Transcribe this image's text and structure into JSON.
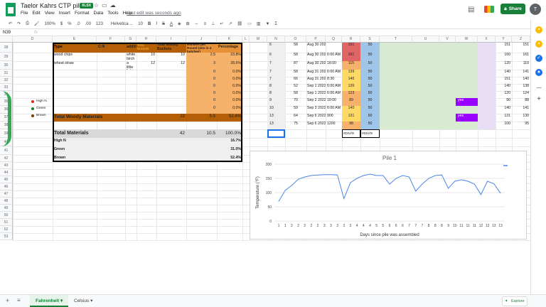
{
  "app": {
    "title": "Taelor Kahrs CTP pile 2",
    "file_badge": "XLSX",
    "last_edit": "Last edit was seconds ago",
    "share_label": "Share",
    "avatar_letter": "T",
    "menu": [
      "File",
      "Edit",
      "View",
      "Insert",
      "Format",
      "Data",
      "Tools",
      "Help"
    ]
  },
  "toolbar": {
    "zoom": "100%",
    "currency": "$",
    "percent": "%",
    "dec_decrease": ".0",
    "dec_increase": ".00",
    "number_format": "123",
    "font": "Helvetica ...",
    "font_size": "10",
    "bold": "B",
    "italic": "I",
    "strike": "S",
    "text_color": "A"
  },
  "formula_bar": {
    "cell_ref": "N39",
    "fx": "fx"
  },
  "columns": [
    "D",
    "E",
    "F",
    "G",
    "H",
    "I",
    "J",
    "K",
    "L",
    "M",
    "N",
    "O",
    "P",
    "Q",
    "R",
    "S",
    "T",
    "U",
    "V",
    "W",
    "X",
    "Y",
    "Z"
  ],
  "rows": [
    "28",
    "29",
    "30",
    "31",
    "32",
    "33",
    "34",
    "35",
    "36",
    "37",
    "38",
    "39",
    "40",
    "41",
    "42",
    "43",
    "44",
    "45",
    "46",
    "47",
    "48",
    "49",
    "50",
    "51",
    "52",
    "53"
  ],
  "legend": [
    {
      "label": "High N",
      "color": "#d93025"
    },
    {
      "label": "Green",
      "color": "#188038"
    },
    {
      "label": "Brown",
      "color": "#7b3f00"
    }
  ],
  "materials": {
    "headers": {
      "type": "Type",
      "cn": "C:N",
      "notes": "additional notes",
      "total": "Total Buckets",
      "true_woody": "True Woody Buckets",
      "per_round": "Buckets per Round (mix in 4 batches)",
      "pct": "Percentage"
    },
    "rows": [
      {
        "type": "wood chips",
        "notes": "white birch",
        "total": "10",
        "true": "10",
        "round": "2.5",
        "pct": "23.8%"
      },
      {
        "type": "wheat straw",
        "notes": "a little lighter than wood chips",
        "total": "12",
        "true": "12",
        "round": "3",
        "pct": "28.6%"
      },
      {
        "round": "0",
        "pct": "0.0%"
      },
      {
        "round": "0",
        "pct": "0.0%"
      },
      {
        "round": "0",
        "pct": "0.0%"
      },
      {
        "round": "0",
        "pct": "0.0%"
      },
      {
        "round": "0",
        "pct": "0.0%"
      },
      {
        "round": "0",
        "pct": "0.0%"
      }
    ],
    "total_woody": {
      "label": "Total Woody Materials",
      "true": "22",
      "round": "5.5",
      "pct": "52.4%"
    },
    "total": {
      "label": "Total Materials",
      "true": "42",
      "round": "10.5",
      "pct": "100.0%"
    },
    "summary": [
      {
        "label": "High N",
        "pct": "16.7%"
      },
      {
        "label": "Green",
        "pct": "31.0%"
      },
      {
        "label": "Brown",
        "pct": "52.4%"
      }
    ]
  },
  "log": {
    "rows": [
      {
        "n": "6",
        "o": "58",
        "p": "Aug 30 2022",
        "q": "",
        "r": "151",
        "s": "50",
        "y": "151",
        "z": "151"
      },
      {
        "n": "6",
        "o": "58",
        "p": "Aug 30 2022",
        "q": "6:00 AM",
        "r": "161",
        "s": "50",
        "y": "160",
        "z": "161"
      },
      {
        "n": "7",
        "o": "87",
        "p": "Aug 30 2022",
        "q": "18:00",
        "r": "115",
        "s": "50",
        "y": "120",
        "z": "110"
      },
      {
        "n": "7",
        "o": "58",
        "p": "Aug 31 2022",
        "q": "6:00 AM",
        "r": "139",
        "s": "50",
        "y": "140",
        "z": "141"
      },
      {
        "n": "7",
        "o": "66",
        "p": "Aug 31 2022",
        "q": "8:30",
        "r": "146",
        "s": "50",
        "y": "151",
        "z": "140"
      },
      {
        "n": "8",
        "o": "52",
        "p": "Sep 1 2022",
        "q": "6:00 AM",
        "r": "139",
        "s": "50",
        "y": "140",
        "z": "138"
      },
      {
        "n": "8",
        "o": "58",
        "p": "Sep 1 2022",
        "q": "6:00 AM",
        "r": "123",
        "s": "50",
        "y": "120",
        "z": "124"
      },
      {
        "n": "9",
        "o": "70",
        "p": "Sep 2 2022",
        "q": "10:00",
        "r": "89",
        "s": "50",
        "w": "yes",
        "y": "90",
        "z": "88"
      },
      {
        "n": "10",
        "o": "59",
        "p": "Sep 3 2022",
        "q": "6:00 AM",
        "r": "140",
        "s": "50",
        "y": "140",
        "z": "141"
      },
      {
        "n": "13",
        "o": "64",
        "p": "Sep 6 2022",
        "q": "900",
        "r": "131",
        "s": "50",
        "w": "yes",
        "y": "131",
        "z": "130"
      },
      {
        "n": "13",
        "o": "75",
        "p": "Sep 6 2022",
        "q": "1200",
        "r": "98",
        "s": "50",
        "y": "100",
        "z": "95"
      }
    ],
    "div_r": "#DIV/0!",
    "div_s": "#DIV/0!"
  },
  "chart_data": {
    "type": "line",
    "title": "Pile 1",
    "xlabel": "Days since pile was assembled",
    "ylabel": "Temperature (°F)",
    "ylim": [
      0,
      200
    ],
    "yticks": [
      0,
      50,
      100,
      150,
      200
    ],
    "x": [
      "1",
      "1",
      "2",
      "2",
      "2",
      "2",
      "2",
      "3",
      "3",
      "3",
      "3",
      "3",
      "4",
      "4",
      "4",
      "5",
      "5",
      "6",
      "6",
      "6",
      "7",
      "7",
      "7",
      "8",
      "8",
      "8",
      "9",
      "10",
      "11",
      "11",
      "11",
      "12",
      "12",
      "13",
      "13"
    ],
    "series": [
      {
        "values": [
          69,
          108,
          125,
          147,
          155,
          160,
          162,
          163,
          163,
          162,
          79,
          135,
          150,
          160,
          165,
          160,
          160,
          130,
          150,
          160,
          155,
          105,
          130,
          150,
          160,
          162,
          115,
          140,
          145,
          140,
          130,
          93,
          140,
          131,
          98
        ]
      }
    ],
    "grid": true,
    "line_color": "#4a86e8"
  },
  "sheets": {
    "tabs": [
      "Fahrenheit",
      "Celsius"
    ],
    "explore": "Explore"
  }
}
